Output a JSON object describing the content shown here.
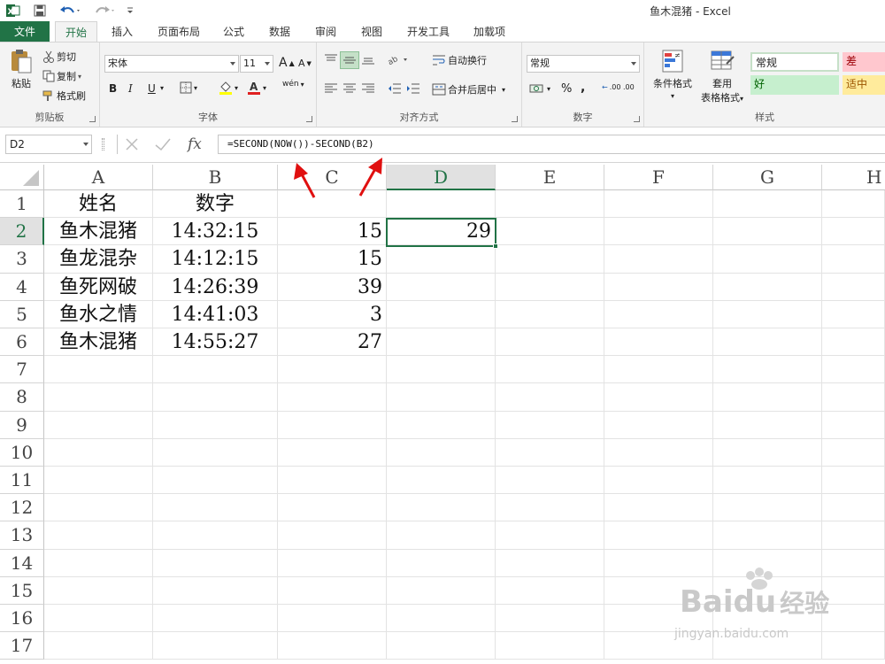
{
  "window": {
    "title": "鱼木混猪 - Excel"
  },
  "tabs": [
    {
      "label": "文件"
    },
    {
      "label": "开始"
    },
    {
      "label": "插入"
    },
    {
      "label": "页面布局"
    },
    {
      "label": "公式"
    },
    {
      "label": "数据"
    },
    {
      "label": "审阅"
    },
    {
      "label": "视图"
    },
    {
      "label": "开发工具"
    },
    {
      "label": "加载项"
    }
  ],
  "ribbon": {
    "clipboard": {
      "label": "剪贴板",
      "paste": "粘贴",
      "cut": "剪切",
      "copy": "复制",
      "format_painter": "格式刷"
    },
    "font": {
      "label": "字体",
      "name": "宋体",
      "size": "11",
      "bold": "B",
      "italic": "I",
      "underline": "U",
      "grow": "A",
      "shrink": "A",
      "phonetic": "wén"
    },
    "alignment": {
      "label": "对齐方式",
      "wrap": "自动换行",
      "merge": "合并后居中"
    },
    "number": {
      "label": "数字",
      "format": "常规",
      "percent": "%",
      "comma": ",",
      "inc_decimal": ".00",
      "dec_decimal": ".00"
    },
    "styles": {
      "label": "样式",
      "conditional": "条件格式",
      "table_format_1": "套用",
      "table_format_2": "表格格式",
      "normal": "常规",
      "bad": "差",
      "good": "好",
      "neutral": "适中"
    }
  },
  "formula_bar": {
    "name_box": "D2",
    "fx": "fx",
    "formula": "=SECOND(NOW())-SECOND(B2)"
  },
  "sheet": {
    "columns": [
      "A",
      "B",
      "C",
      "D",
      "E",
      "F",
      "G",
      "H"
    ],
    "rows": [
      "1",
      "2",
      "3",
      "4",
      "5",
      "6",
      "7",
      "8",
      "9",
      "10",
      "11",
      "12",
      "13",
      "14",
      "15",
      "16",
      "17"
    ],
    "header": {
      "a": "姓名",
      "b": "数字"
    },
    "data": [
      {
        "a": "鱼木混猪",
        "b": "14:32:15",
        "c": "15",
        "d": "29"
      },
      {
        "a": "鱼龙混杂",
        "b": "14:12:15",
        "c": "15",
        "d": ""
      },
      {
        "a": "鱼死网破",
        "b": "14:26:39",
        "c": "39",
        "d": ""
      },
      {
        "a": "鱼水之情",
        "b": "14:41:03",
        "c": "3",
        "d": ""
      },
      {
        "a": "鱼木混猪",
        "b": "14:55:27",
        "c": "27",
        "d": ""
      }
    ]
  },
  "watermark": {
    "brand": "Bai",
    "brand2": "du",
    "brand3": "经验",
    "url": "jingyan.baidu.com"
  },
  "colors": {
    "excel_green": "#217346",
    "ribbon_bg": "#f3f3f3",
    "arrow": "#e01010",
    "good_fill": "#c6efce",
    "bad_fill": "#ffc7ce",
    "neutral_fill": "#ffeb9c"
  }
}
